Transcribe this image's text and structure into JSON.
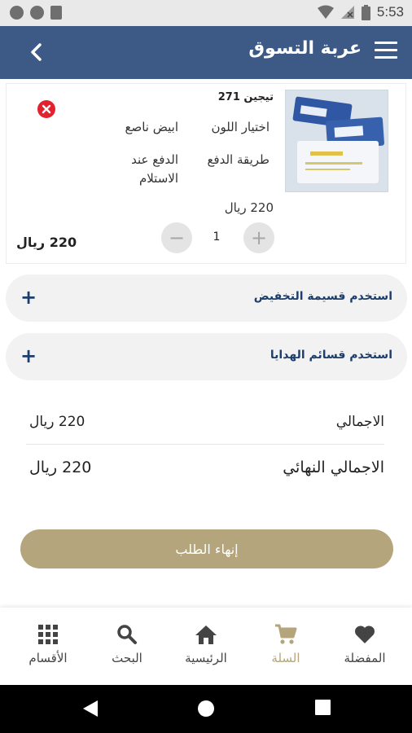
{
  "status_bar": {
    "time": "5:53"
  },
  "header": {
    "title": "عربة التسوق"
  },
  "cart_item": {
    "name": "تيجين 271",
    "color_label": "اختيار اللون",
    "color_value": "ابيض ناصع",
    "payment_label": "طريقة الدفع",
    "payment_value_line1": "الدفع عند",
    "payment_value_line2": "الاستلام",
    "price": "220 ريال",
    "quantity": "1",
    "line_total": "220 ريال",
    "decrement_symbol": "−",
    "increment_symbol": "+"
  },
  "coupons": [
    {
      "label": "استخدم قسيمة التخفيض",
      "symbol": "+"
    },
    {
      "label": "استخدم قسائم الهدايا",
      "symbol": "+"
    }
  ],
  "summary": {
    "subtotal_label": "الاجمالي",
    "subtotal_value": "220 ريال",
    "grand_total_label": "الاجمالي النهائي",
    "grand_total_value": "220 ريال"
  },
  "checkout_label": "إنهاء الطلب",
  "bottom_nav": [
    {
      "label": "المفضلة",
      "icon": "heart-icon"
    },
    {
      "label": "السلة",
      "icon": "cart-icon",
      "active": true
    },
    {
      "label": "الرئيسية",
      "icon": "home-icon"
    },
    {
      "label": "البحث",
      "icon": "search-icon"
    },
    {
      "label": "الأقسام",
      "icon": "grid-icon"
    }
  ],
  "colors": {
    "header": "#3d5a87",
    "accent_gold": "#b5a57c",
    "remove_red": "#e2222f",
    "link_blue": "#1e3e6b"
  }
}
